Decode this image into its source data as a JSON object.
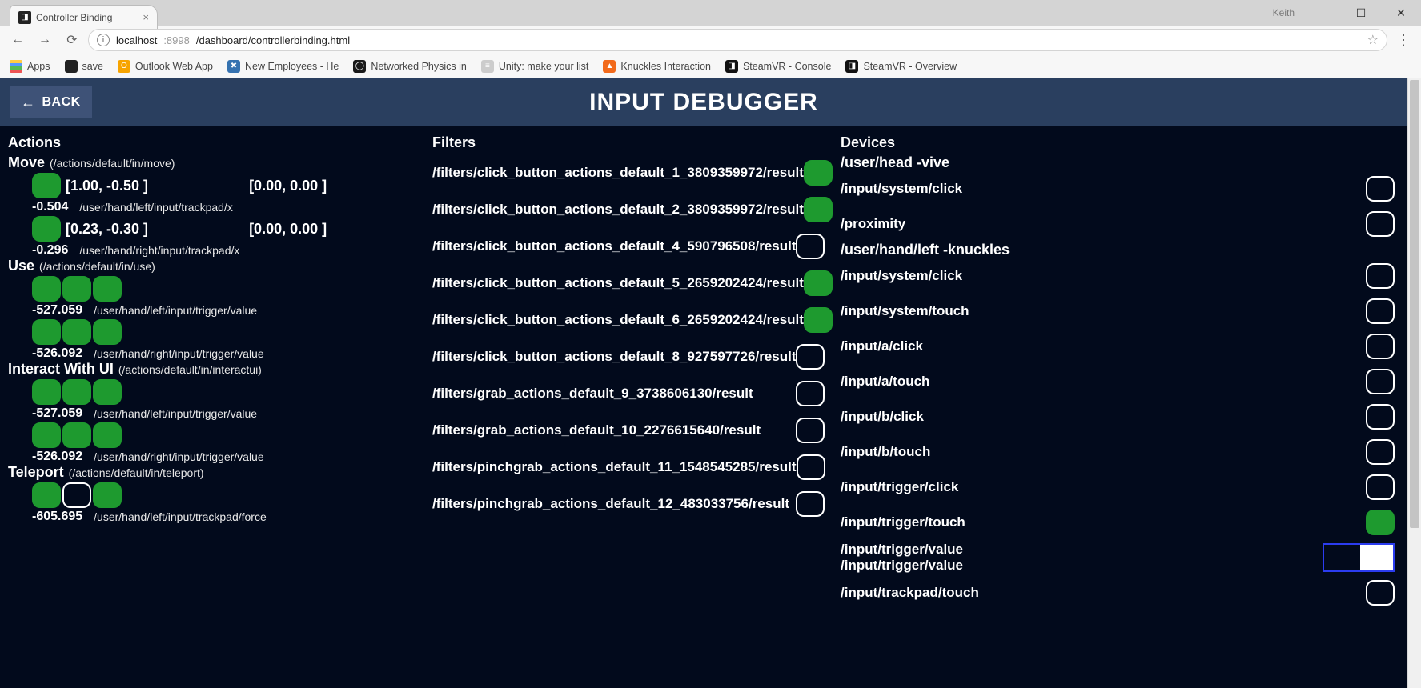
{
  "window": {
    "user": "Keith",
    "tab_title": "Controller Binding"
  },
  "url": {
    "host": "localhost",
    "port": ":8998",
    "path": "/dashboard/controllerbinding.html"
  },
  "bookmarks": {
    "apps": "Apps",
    "save": "save",
    "outlook": "Outlook Web App",
    "newemp": "New Employees - He",
    "netphys": "Networked Physics in",
    "unitylist": "Unity: make your list",
    "knuckles": "Knuckles Interaction",
    "svcons": "SteamVR - Console",
    "svover": "SteamVR - Overview"
  },
  "header": {
    "back": "BACK",
    "title": "INPUT DEBUGGER"
  },
  "columns": {
    "actions_title": "Actions",
    "filters_title": "Filters",
    "devices_title": "Devices"
  },
  "actions": [
    {
      "name": "Move",
      "path": "(/actions/default/in/move)",
      "rows": [
        {
          "type": "vec2",
          "pill_on": true,
          "v1": "[1.00, -0.50 ]",
          "v2": "[0.00, 0.00 ]",
          "val": "-0.504",
          "src": "/user/hand/left/input/trackpad/x"
        },
        {
          "type": "vec2",
          "pill_on": true,
          "v1": "[0.23, -0.30 ]",
          "v2": "[0.00, 0.00 ]",
          "val": "-0.296",
          "src": "/user/hand/right/input/trackpad/x"
        }
      ]
    },
    {
      "name": "Use",
      "path": "(/actions/default/in/use)",
      "rows": [
        {
          "type": "triple",
          "pills": [
            true,
            true,
            true
          ],
          "val": "-527.059",
          "src": "/user/hand/left/input/trigger/value"
        },
        {
          "type": "triple",
          "pills": [
            true,
            true,
            true
          ],
          "val": "-526.092",
          "src": "/user/hand/right/input/trigger/value"
        }
      ]
    },
    {
      "name": "Interact With UI",
      "path": "(/actions/default/in/interactui)",
      "rows": [
        {
          "type": "triple",
          "pills": [
            true,
            true,
            true
          ],
          "val": "-527.059",
          "src": "/user/hand/left/input/trigger/value"
        },
        {
          "type": "triple",
          "pills": [
            true,
            true,
            true
          ],
          "val": "-526.092",
          "src": "/user/hand/right/input/trigger/value"
        }
      ]
    },
    {
      "name": "Teleport",
      "path": "(/actions/default/in/teleport)",
      "rows": [
        {
          "type": "triple",
          "pills": [
            true,
            false,
            true
          ],
          "val": "-605.695",
          "src": "/user/hand/left/input/trackpad/force"
        }
      ]
    }
  ],
  "filters": [
    {
      "path": "/filters/click_button_actions_default_1_3809359972/result",
      "on": true
    },
    {
      "path": "/filters/click_button_actions_default_2_3809359972/result",
      "on": true
    },
    {
      "path": "/filters/click_button_actions_default_4_590796508/result",
      "on": false
    },
    {
      "path": "/filters/click_button_actions_default_5_2659202424/result",
      "on": true
    },
    {
      "path": "/filters/click_button_actions_default_6_2659202424/result",
      "on": true
    },
    {
      "path": "/filters/click_button_actions_default_8_927597726/result",
      "on": false
    },
    {
      "path": "/filters/grab_actions_default_9_3738606130/result",
      "on": false
    },
    {
      "path": "/filters/grab_actions_default_10_2276615640/result",
      "on": false
    },
    {
      "path": "/filters/pinchgrab_actions_default_11_1548545285/result",
      "on": false
    },
    {
      "path": "/filters/pinchgrab_actions_default_12_483033756/result",
      "on": false
    }
  ],
  "devices": {
    "head": {
      "title": "/user/head -vive",
      "rows": [
        {
          "path": "/input/system/click",
          "on": false
        },
        {
          "path": "/proximity",
          "on": false
        }
      ]
    },
    "left": {
      "title": "/user/hand/left -knuckles",
      "rows": [
        {
          "path": "/input/system/click",
          "on": false
        },
        {
          "path": "/input/system/touch",
          "on": false
        },
        {
          "path": "/input/a/click",
          "on": false
        },
        {
          "path": "/input/a/touch",
          "on": false
        },
        {
          "path": "/input/b/click",
          "on": false
        },
        {
          "path": "/input/b/touch",
          "on": false
        },
        {
          "path": "/input/trigger/click",
          "on": false
        },
        {
          "path": "/input/trigger/touch",
          "on": true
        }
      ],
      "value_row": {
        "path1": "/input/trigger/value",
        "path2": "/input/trigger/value",
        "fill_pct": 48
      },
      "extra_row": {
        "path": "/input/trackpad/touch",
        "on": false
      }
    }
  }
}
